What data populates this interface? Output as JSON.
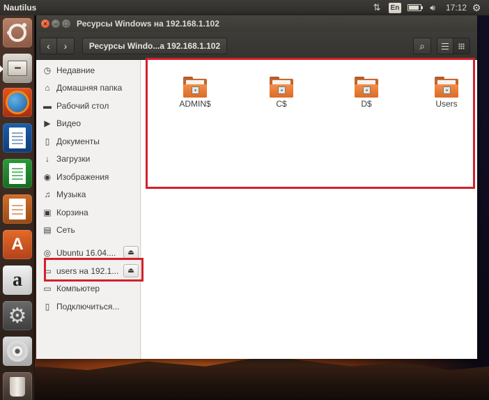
{
  "top_panel": {
    "app_title": "Nautilus",
    "lang": "En",
    "time": "17:12"
  },
  "window": {
    "title": "Ресурсы Windows на 192.168.1.102",
    "path_button": "Ресурсы Windo...а 192.168.1.102",
    "close_glyph": "×",
    "minimize_glyph": "–",
    "maximize_glyph": "□"
  },
  "sidebar": {
    "places": [
      {
        "label": "Недавние",
        "icon": "clock-icon"
      },
      {
        "label": "Домашняя папка",
        "icon": "home-icon"
      },
      {
        "label": "Рабочий стол",
        "icon": "folder-icon"
      },
      {
        "label": "Видео",
        "icon": "video-icon"
      },
      {
        "label": "Документы",
        "icon": "document-icon"
      },
      {
        "label": "Загрузки",
        "icon": "download-icon"
      },
      {
        "label": "Изображения",
        "icon": "camera-icon"
      },
      {
        "label": "Музыка",
        "icon": "music-icon"
      },
      {
        "label": "Корзина",
        "icon": "trash-icon"
      },
      {
        "label": "Сеть",
        "icon": "network-icon"
      }
    ],
    "devices": [
      {
        "label": "Ubuntu 16.04....",
        "icon": "disc-icon"
      },
      {
        "label": "users на 192.1...",
        "icon": "network-share-icon"
      },
      {
        "label": "Компьютер",
        "icon": "computer-icon"
      },
      {
        "label": "Подключиться...",
        "icon": "connect-server-icon"
      }
    ]
  },
  "shares": [
    {
      "label": "ADMIN$"
    },
    {
      "label": "C$"
    },
    {
      "label": "D$"
    },
    {
      "label": "Users"
    }
  ],
  "colors": {
    "accent_orange": "#dd6a24",
    "annotation_red": "#d4202a",
    "panel_dark": "#3c3b37"
  }
}
